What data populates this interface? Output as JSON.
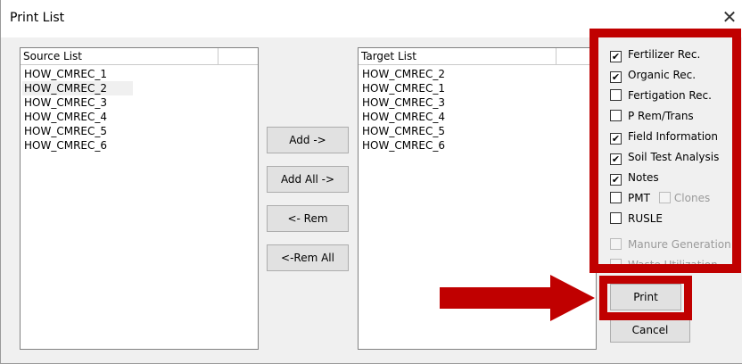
{
  "window": {
    "title": "Print List",
    "close_glyph": "✕"
  },
  "source_list": {
    "header": "Source List",
    "items": [
      "HOW_CMREC_1",
      "HOW_CMREC_2",
      "HOW_CMREC_3",
      "HOW_CMREC_4",
      "HOW_CMREC_5",
      "HOW_CMREC_6"
    ],
    "selected_index": 1
  },
  "target_list": {
    "header": "Target List",
    "items": [
      "HOW_CMREC_2",
      "HOW_CMREC_1",
      "HOW_CMREC_3",
      "HOW_CMREC_4",
      "HOW_CMREC_5",
      "HOW_CMREC_6"
    ]
  },
  "buttons": {
    "add": "Add ->",
    "add_all": "Add All ->",
    "rem": "<- Rem",
    "rem_all": "<-Rem All",
    "print": "Print",
    "cancel": "Cancel"
  },
  "options": [
    {
      "label": "Fertilizer Rec.",
      "checked": true,
      "enabled": true
    },
    {
      "label": "Organic Rec.",
      "checked": true,
      "enabled": true
    },
    {
      "label": "Fertigation Rec.",
      "checked": false,
      "enabled": true
    },
    {
      "label": "P Rem/Trans",
      "checked": false,
      "enabled": true
    },
    {
      "label": "Field Information",
      "checked": true,
      "enabled": true
    },
    {
      "label": "Soil Test Analysis",
      "checked": true,
      "enabled": true
    },
    {
      "label": "Notes",
      "checked": true,
      "enabled": true
    },
    {
      "label": "PMT",
      "checked": false,
      "enabled": true
    },
    {
      "label": "RUSLE",
      "checked": false,
      "enabled": true
    },
    {
      "label": "Manure Generation",
      "checked": false,
      "enabled": false
    },
    {
      "label": "Waste Utilization",
      "checked": false,
      "enabled": false
    }
  ],
  "clones_option": {
    "label": "Clones",
    "checked": false,
    "enabled": false
  },
  "check_glyph": "✔",
  "annotation_color": "#c00000"
}
